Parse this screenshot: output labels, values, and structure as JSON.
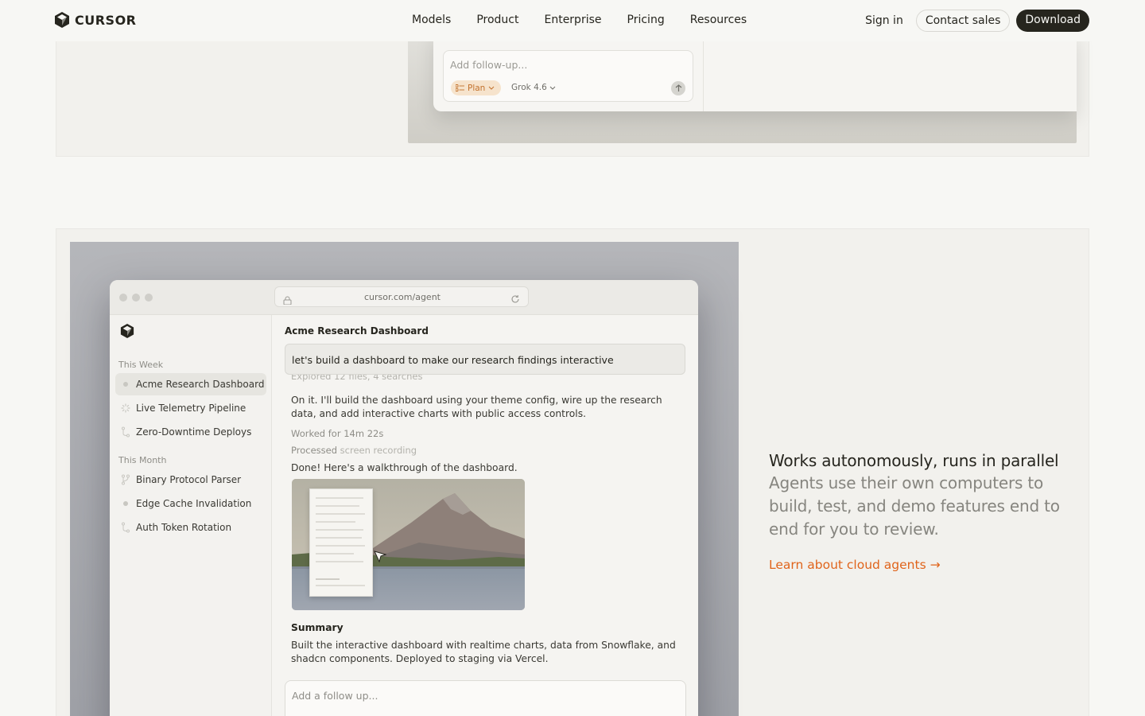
{
  "nav": {
    "logo_text": "CURSOR",
    "links": [
      "Models",
      "Product",
      "Enterprise",
      "Pricing",
      "Resources"
    ],
    "sign_in": "Sign in",
    "contact_sales": "Contact sales",
    "download": "Download"
  },
  "top_preview": {
    "followup_placeholder": "Add follow-up...",
    "mode_label": "Plan",
    "model_label": "Grok 4.6"
  },
  "demo": {
    "url": "cursor.com/agent",
    "sidebar": {
      "this_week": "This Week",
      "this_month": "This Month",
      "items_week": [
        {
          "label": "Acme Research Dashboard",
          "icon": "dot-icon"
        },
        {
          "label": "Live Telemetry Pipeline",
          "icon": "spinner-icon"
        },
        {
          "label": "Zero-Downtime Deploys",
          "icon": "branch-icon"
        }
      ],
      "items_month": [
        {
          "label": "Binary Protocol Parser",
          "icon": "branch-icon"
        },
        {
          "label": "Edge Cache Invalidation",
          "icon": "dot-icon"
        },
        {
          "label": "Auth Token Rotation",
          "icon": "branch-icon"
        }
      ]
    },
    "conversation": {
      "title": "Acme Research Dashboard",
      "user_message": "let's build a dashboard to make our research findings interactive",
      "explored": "Explored 12 files, 4 searches",
      "reply_1": "On it. I'll build the dashboard using your theme config, wire up the research data, and add interactive charts with public access controls.",
      "worked_for": "Worked for 14m 22s",
      "processed_label": "Processed",
      "processed_value": "screen recording",
      "reply_2": "Done! Here's a walkthrough of the dashboard.",
      "summary_heading": "Summary",
      "summary_text": "Built the interactive dashboard with realtime charts, data from Snowflake, and shadcn components. Deployed to staging via Vercel.",
      "followup_placeholder": "Add a follow up..."
    }
  },
  "feature": {
    "title": "Works autonomously, runs in parallel",
    "description": "Agents use their own computers to build, test, and demo features end to end for you to review.",
    "link": "Learn about cloud agents →",
    "link_color": "#e0641b"
  }
}
